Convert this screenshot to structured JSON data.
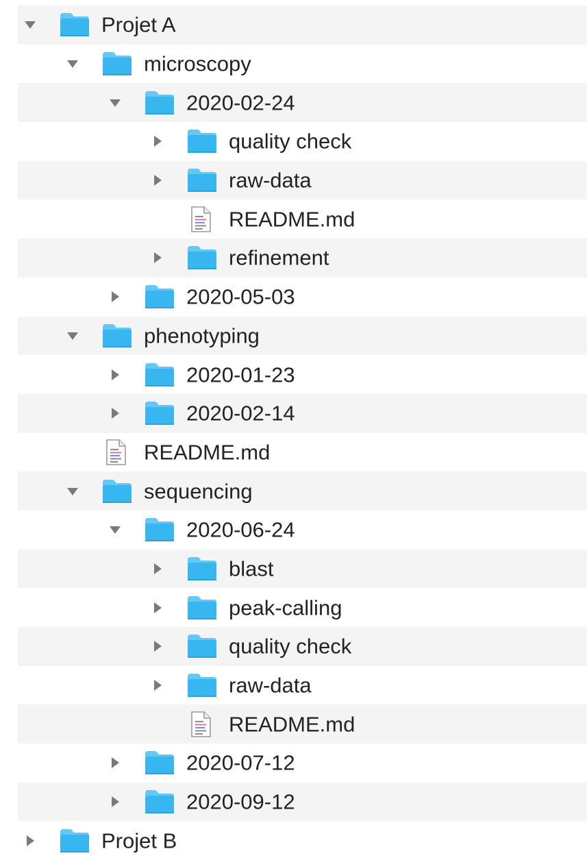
{
  "colors": {
    "folder_fill": "#38b6ef",
    "folder_fill_dark": "#2aa3dd",
    "folder_tab": "#67c7f3",
    "disclosure": "#7a7a7a",
    "row_alt": "#f4f4f4",
    "text": "#232323"
  },
  "tree": [
    {
      "label": "Projet A",
      "type": "folder",
      "depth": 0,
      "state": "expanded"
    },
    {
      "label": "microscopy",
      "type": "folder",
      "depth": 1,
      "state": "expanded"
    },
    {
      "label": "2020-02-24",
      "type": "folder",
      "depth": 2,
      "state": "expanded"
    },
    {
      "label": "quality check",
      "type": "folder",
      "depth": 3,
      "state": "collapsed"
    },
    {
      "label": "raw-data",
      "type": "folder",
      "depth": 3,
      "state": "collapsed"
    },
    {
      "label": "README.md",
      "type": "file",
      "depth": 3,
      "state": "none"
    },
    {
      "label": "refinement",
      "type": "folder",
      "depth": 3,
      "state": "collapsed"
    },
    {
      "label": "2020-05-03",
      "type": "folder",
      "depth": 2,
      "state": "collapsed"
    },
    {
      "label": "phenotyping",
      "type": "folder",
      "depth": 1,
      "state": "expanded"
    },
    {
      "label": "2020-01-23",
      "type": "folder",
      "depth": 2,
      "state": "collapsed"
    },
    {
      "label": "2020-02-14",
      "type": "folder",
      "depth": 2,
      "state": "collapsed"
    },
    {
      "label": "README.md",
      "type": "file",
      "depth": 1,
      "state": "none"
    },
    {
      "label": "sequencing",
      "type": "folder",
      "depth": 1,
      "state": "expanded"
    },
    {
      "label": "2020-06-24",
      "type": "folder",
      "depth": 2,
      "state": "expanded"
    },
    {
      "label": "blast",
      "type": "folder",
      "depth": 3,
      "state": "collapsed"
    },
    {
      "label": "peak-calling",
      "type": "folder",
      "depth": 3,
      "state": "collapsed"
    },
    {
      "label": "quality check",
      "type": "folder",
      "depth": 3,
      "state": "collapsed"
    },
    {
      "label": "raw-data",
      "type": "folder",
      "depth": 3,
      "state": "collapsed"
    },
    {
      "label": "README.md",
      "type": "file",
      "depth": 3,
      "state": "none"
    },
    {
      "label": "2020-07-12",
      "type": "folder",
      "depth": 2,
      "state": "collapsed"
    },
    {
      "label": "2020-09-12",
      "type": "folder",
      "depth": 2,
      "state": "collapsed"
    },
    {
      "label": "Projet B",
      "type": "folder",
      "depth": 0,
      "state": "collapsed"
    }
  ]
}
